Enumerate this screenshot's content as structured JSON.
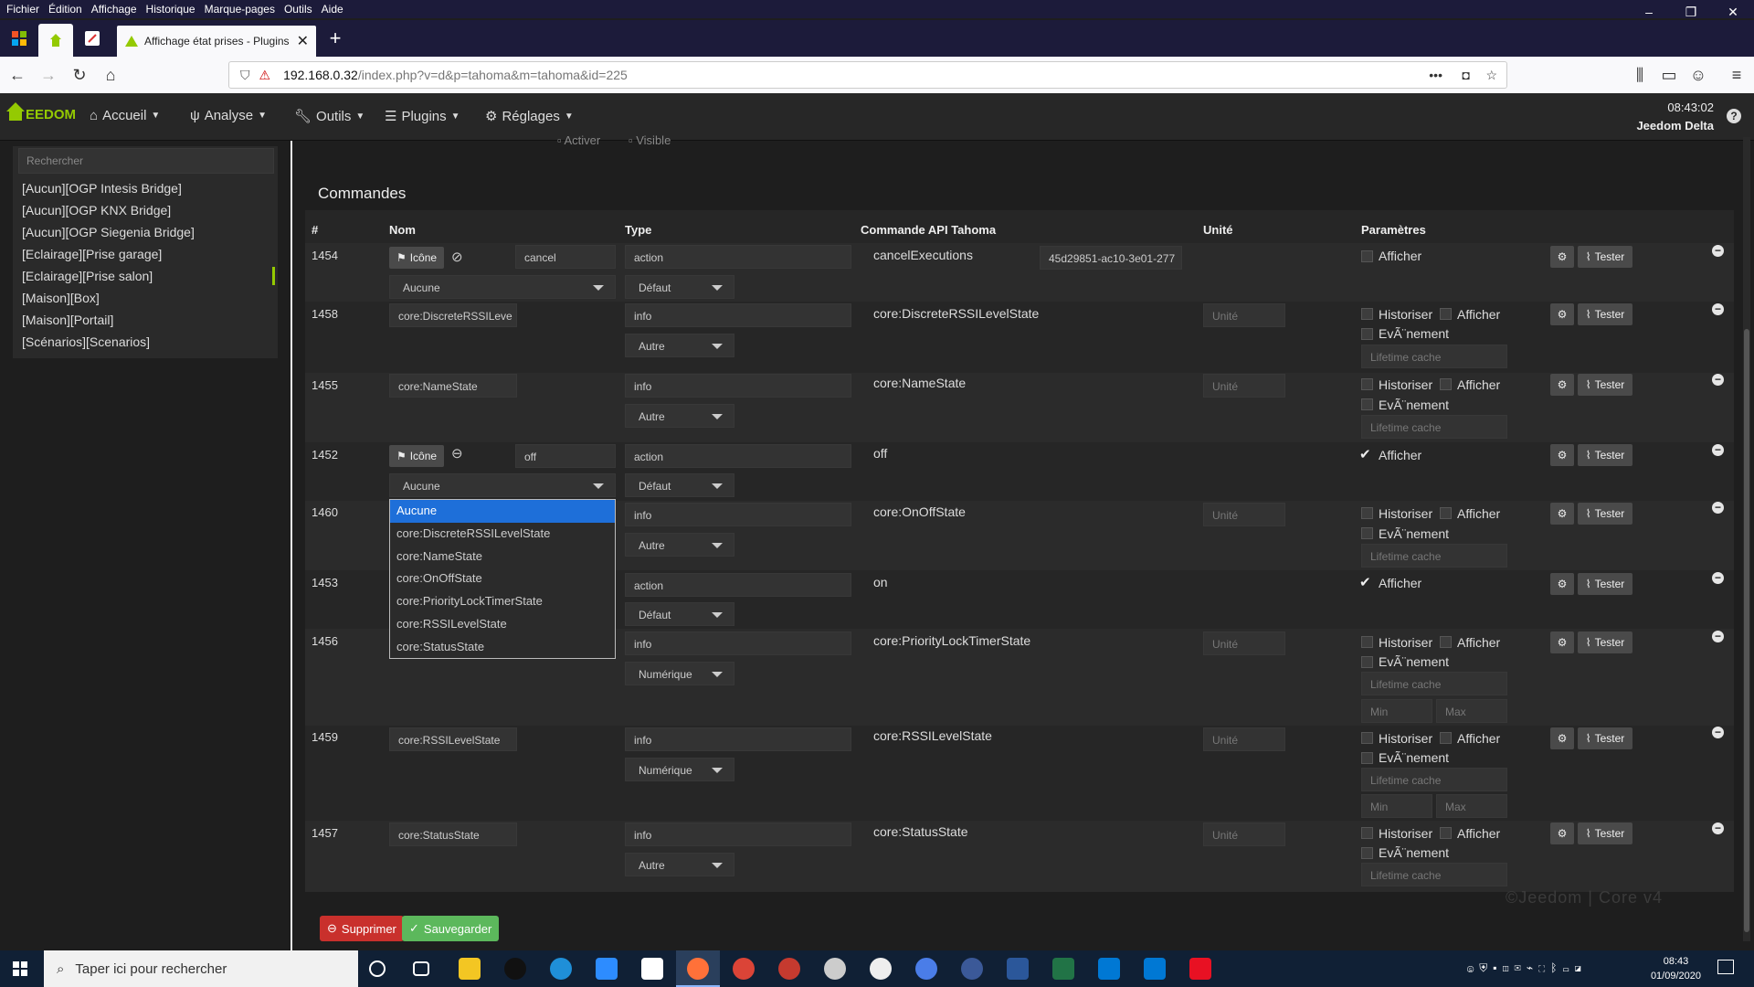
{
  "browser": {
    "menu": [
      "Fichier",
      "Édition",
      "Affichage",
      "Historique",
      "Marque-pages",
      "Outils",
      "Aide"
    ],
    "window_controls": [
      "–",
      "❐",
      "✕"
    ],
    "tab_title": "Affichage état prises - Plugins",
    "url_host": "192.168.0.32",
    "url_path": "/index.php?v=d&p=tahoma&m=tahoma&id=225"
  },
  "jeedom": {
    "logo": "EEDOM",
    "menu": [
      "Accueil",
      "Analyse",
      "Outils",
      "Plugins",
      "Réglages"
    ],
    "time": "08:43:02",
    "user": "Jeedom Delta",
    "partial_checks": [
      "Activer",
      "Visible"
    ]
  },
  "sidebar": {
    "search_placeholder": "Rechercher",
    "items": [
      "[Aucun][OGP Intesis Bridge]",
      "[Aucun][OGP KNX Bridge]",
      "[Aucun][OGP Siegenia Bridge]",
      "[Eclairage][Prise garage]",
      "[Eclairage][Prise salon]",
      "[Maison][Box]",
      "[Maison][Portail]",
      "[Scénarios][Scenarios]"
    ]
  },
  "commands": {
    "title": "Commandes",
    "headers": [
      "#",
      "Nom",
      "Type",
      "Commande API Tahoma",
      "Unité",
      "Paramètres"
    ],
    "icon_btn": "Icône",
    "tester": "Tester",
    "unit_placeholder": "Unité",
    "lifetime_placeholder": "Lifetime cache",
    "min_placeholder": "Min",
    "max_placeholder": "Max",
    "historiser": "Historiser",
    "afficher": "Afficher",
    "evenement": "EvÃ¨nement",
    "rows": [
      {
        "id": "1454",
        "name": "cancel",
        "type": "action",
        "subtype": "Défaut",
        "api": "cancelExecutions",
        "extra": "45d29851-ac10-3e01-277"
      },
      {
        "id": "1458",
        "name": "core:DiscreteRSSILeve",
        "type": "info",
        "subtype": "Autre",
        "api": "core:DiscreteRSSILevelState"
      },
      {
        "id": "1455",
        "name": "core:NameState",
        "type": "info",
        "subtype": "Autre",
        "api": "core:NameState"
      },
      {
        "id": "1452",
        "name": "off",
        "type": "action",
        "subtype": "Défaut",
        "api": "off"
      },
      {
        "id": "1460",
        "name": "",
        "type": "info",
        "subtype": "Autre",
        "api": "core:OnOffState"
      },
      {
        "id": "1453",
        "name": "",
        "type": "action",
        "subtype": "Défaut",
        "api": "on"
      },
      {
        "id": "1456",
        "name": "",
        "type": "info",
        "subtype": "Numérique",
        "api": "core:PriorityLockTimerState"
      },
      {
        "id": "1459",
        "name": "core:RSSILevelState",
        "type": "info",
        "subtype": "Numérique",
        "api": "core:RSSILevelState"
      },
      {
        "id": "1457",
        "name": "core:StatusState",
        "type": "info",
        "subtype": "Autre",
        "api": "core:StatusState"
      }
    ],
    "value_select_1454": "Aucune",
    "value_select_1452": "Aucune",
    "dropdown_options": [
      "Aucune",
      "core:DiscreteRSSILevelState",
      "core:NameState",
      "core:OnOffState",
      "core:PriorityLockTimerState",
      "core:RSSILevelState",
      "core:StatusState"
    ]
  },
  "footer": {
    "delete": "Supprimer",
    "save": "Sauvegarder",
    "watermark": "©Jeedom | Core v4"
  },
  "taskbar": {
    "search": "Taper ici pour rechercher",
    "time": "08:43",
    "date": "01/09/2020"
  },
  "colors": {
    "delete_btn": "#c9302c",
    "save_btn": "#5cb85c",
    "dropdown_selected": "#1e6fd9",
    "accent_green": "#94ca02"
  }
}
